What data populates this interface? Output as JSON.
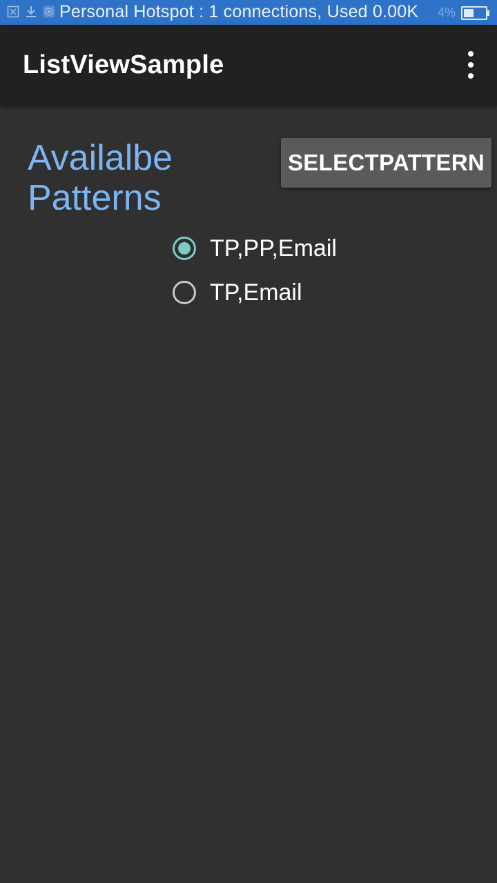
{
  "status_bar": {
    "notification": "Personal Hotspot : 1 connections, Used 0.00K",
    "battery_text": "4%",
    "battery_level": 0.4,
    "color": "#2f73c9",
    "icons": [
      "close-box-icon",
      "download-icon",
      "hotspot-icon"
    ]
  },
  "app_bar": {
    "title": "ListViewSample",
    "menu_icon": "overflow-menu-icon"
  },
  "main": {
    "heading": "Availalbe Patterns",
    "heading_color": "#7cb5f3",
    "select_button_label": "SELECTPATTERN",
    "options": [
      {
        "label": "TP,PP,Email",
        "checked": true
      },
      {
        "label": "TP,Email",
        "checked": false
      }
    ],
    "radio_accent": "#80cbc4"
  }
}
